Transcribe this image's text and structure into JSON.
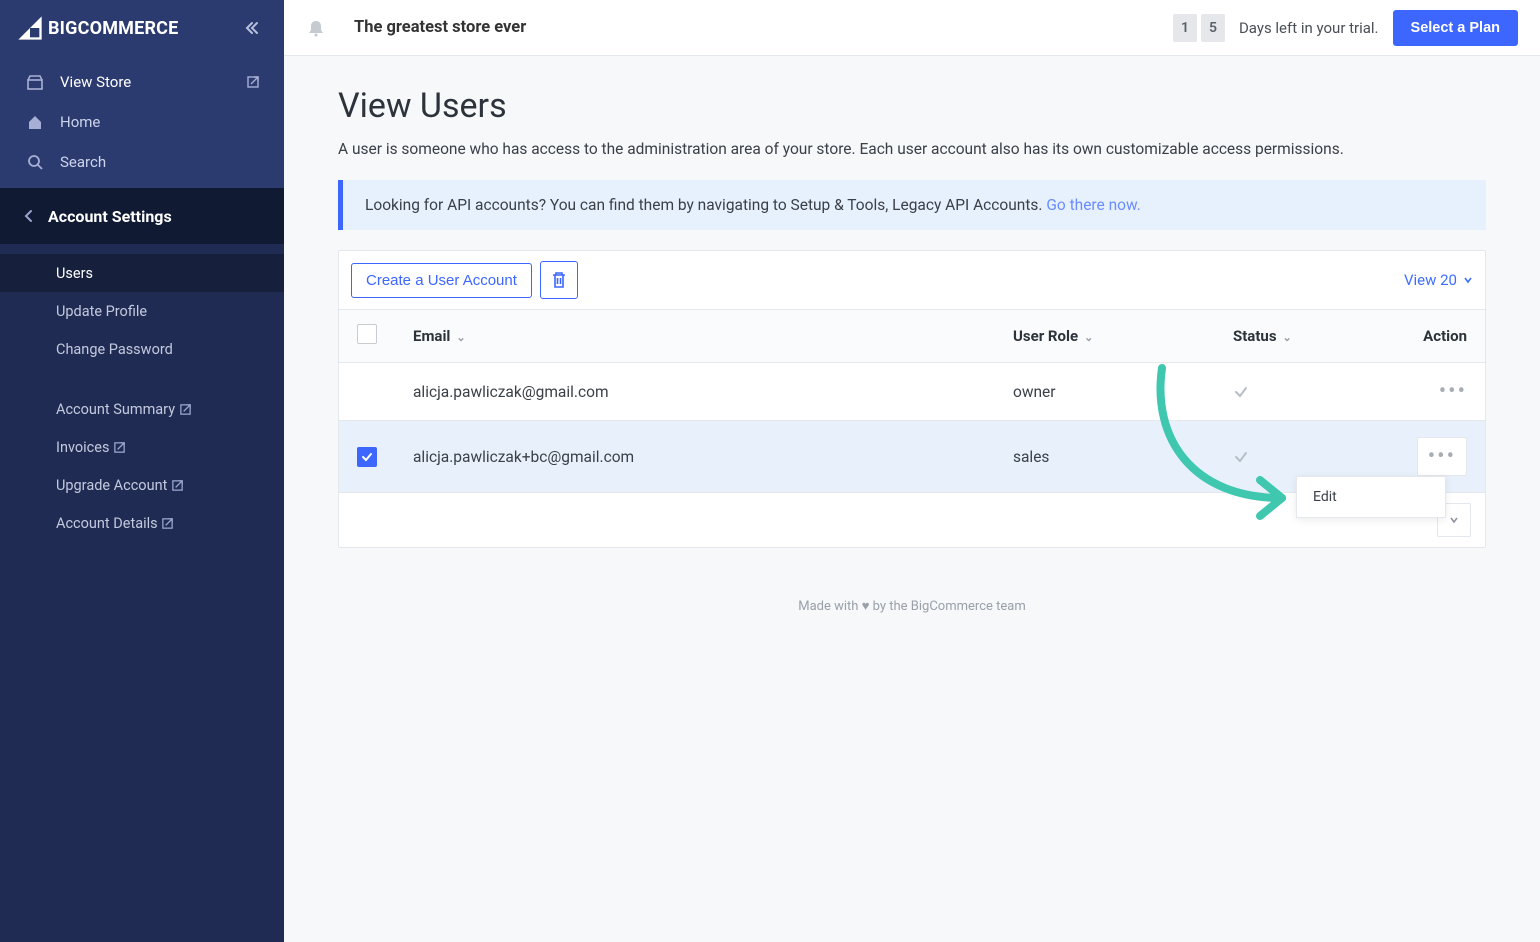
{
  "brand": "BIGCOMMERCE",
  "header": {
    "store_name": "The greatest store ever",
    "trial_digits": [
      "1",
      "5"
    ],
    "trial_text": "Days left in your trial.",
    "plan_button": "Select a Plan"
  },
  "sidebar": {
    "primary": [
      {
        "label": "View Store",
        "icon": "store",
        "external": true
      },
      {
        "label": "Home",
        "icon": "home",
        "external": false
      },
      {
        "label": "Search",
        "icon": "search",
        "external": false
      }
    ],
    "section_title": "Account Settings",
    "sub": [
      {
        "label": "Users",
        "active": true
      },
      {
        "label": "Update Profile"
      },
      {
        "label": "Change Password"
      }
    ],
    "sub2": [
      {
        "label": "Account Summary",
        "external": true
      },
      {
        "label": "Invoices",
        "external": true
      },
      {
        "label": "Upgrade Account",
        "external": true
      },
      {
        "label": "Account Details",
        "external": true
      }
    ]
  },
  "page": {
    "title": "View Users",
    "subtitle": "A user is someone who has access to the administration area of your store. Each user account also has its own customizable access permissions.",
    "info_text": "Looking for API accounts? You can find them by navigating to Setup & Tools, Legacy API Accounts. ",
    "info_link": "Go there now.",
    "create_btn": "Create a User Account",
    "view_label": "View 20",
    "columns": {
      "email": "Email",
      "role": "User Role",
      "status": "Status",
      "action": "Action"
    },
    "rows": [
      {
        "email": "alicja.pawliczak@gmail.com",
        "role": "owner",
        "checked": false,
        "status": "ok"
      },
      {
        "email": "alicja.pawliczak+bc@gmail.com",
        "role": "sales",
        "checked": true,
        "status": "ok"
      }
    ],
    "action_menu": {
      "edit": "Edit"
    }
  },
  "footer": {
    "text_left": "Made with ",
    "text_right": " by the BigCommerce team"
  }
}
